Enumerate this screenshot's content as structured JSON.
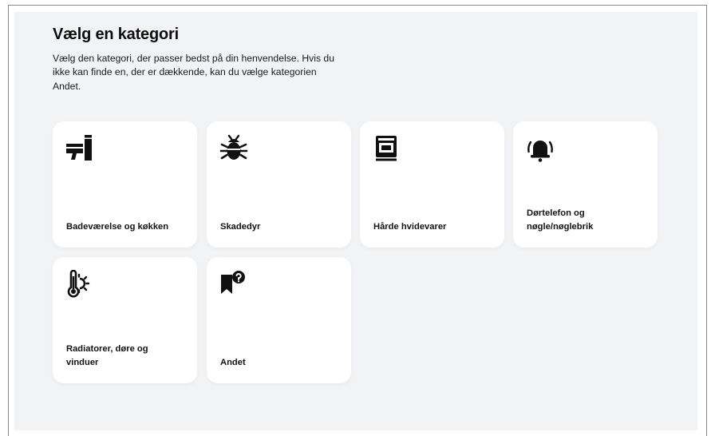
{
  "header": {
    "title": "Vælg en kategori",
    "description": "Vælg den kategori, der passer bedst på din henvendelse. Hvis du ikke kan finde en, der er dækkende, kan du vælge kategorien Andet."
  },
  "categories": [
    {
      "label": "Badeværelse og køkken",
      "icon": "toilet-icon"
    },
    {
      "label": "Skadedyr",
      "icon": "bug-icon"
    },
    {
      "label": "Hårde hvidevarer",
      "icon": "oven-icon"
    },
    {
      "label": "Dørtelefon og nøgle/nøglebrik",
      "icon": "bell-icon"
    },
    {
      "label": "Radiatorer, døre og vinduer",
      "icon": "thermometer-sun-icon"
    },
    {
      "label": "Andet",
      "icon": "bookmark-question-icon"
    }
  ],
  "colors": {
    "background": "#f2f3f5",
    "card": "#ffffff",
    "icon": "#111111"
  }
}
